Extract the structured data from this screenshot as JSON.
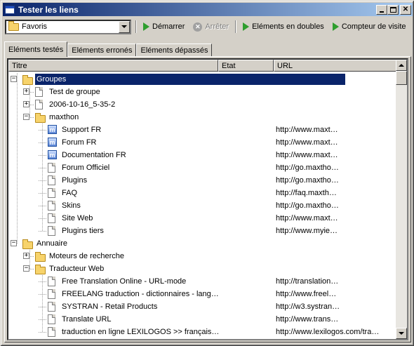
{
  "window": {
    "title": "Tester les liens"
  },
  "toolbar": {
    "combo_value": "Favoris",
    "start": "Démarrer",
    "stop": "Arrêter",
    "duplicates": "Eléments en doubles",
    "visit_counter": "Compteur de visite"
  },
  "tabs": [
    "Eléments testés",
    "Eléments erronés",
    "Eléments dépassés"
  ],
  "columns": {
    "title": "Titre",
    "state": "Etat",
    "url": "URL"
  },
  "rows": [
    {
      "name": "Groupes",
      "url": "",
      "icon": "folder-icon",
      "level": 0,
      "expander": "−",
      "selected": true
    },
    {
      "name": "Test de groupe",
      "url": "",
      "icon": "page-icon",
      "level": 1,
      "expander": "+"
    },
    {
      "name": "2006-10-16_5-35-2",
      "url": "",
      "icon": "page-icon",
      "level": 1,
      "expander": "+"
    },
    {
      "name": "maxthon",
      "url": "",
      "icon": "folder-icon",
      "level": 1,
      "expander": "−"
    },
    {
      "name": "Support FR",
      "url": "http://www.maxt…",
      "icon": "maxthon-icon",
      "level": 2
    },
    {
      "name": "Forum FR",
      "url": "http://www.maxt…",
      "icon": "maxthon-icon",
      "level": 2
    },
    {
      "name": "Documentation FR",
      "url": "http://www.maxt…",
      "icon": "maxthon-icon",
      "level": 2
    },
    {
      "name": "Forum Officiel",
      "url": "http://go.maxtho…",
      "icon": "page-icon",
      "level": 2
    },
    {
      "name": "Plugins",
      "url": "http://go.maxtho…",
      "icon": "page-icon",
      "level": 2
    },
    {
      "name": "FAQ",
      "url": "http://faq.maxth…",
      "icon": "page-icon",
      "level": 2
    },
    {
      "name": "Skins",
      "url": "http://go.maxtho…",
      "icon": "page-icon",
      "level": 2
    },
    {
      "name": "Site Web",
      "url": "http://www.maxt…",
      "icon": "page-icon",
      "level": 2
    },
    {
      "name": "Plugins tiers",
      "url": "http://www.myie…",
      "icon": "page-icon",
      "level": 2
    },
    {
      "name": "Annuaire",
      "url": "",
      "icon": "folder-icon",
      "level": 0,
      "expander": "−"
    },
    {
      "name": "Moteurs de recherche",
      "url": "",
      "icon": "folder-icon",
      "level": 1,
      "expander": "+"
    },
    {
      "name": "Traducteur Web",
      "url": "",
      "icon": "folder-icon",
      "level": 1,
      "expander": "−"
    },
    {
      "name": "Free Translation Online - URL-mode",
      "url": "http://translation…",
      "icon": "page-icon",
      "level": 2
    },
    {
      "name": "FREELANG traduction - dictionnaires - lang…",
      "url": "http://www.freel…",
      "icon": "page-icon",
      "level": 2
    },
    {
      "name": "SYSTRAN - Retail Products",
      "url": "http://w3.systran…",
      "icon": "page-icon",
      "level": 2
    },
    {
      "name": "Translate URL",
      "url": "http://www.trans…",
      "icon": "page-icon",
      "level": 2
    },
    {
      "name": "traduction en ligne LEXILOGOS >> français…",
      "url": "http://www.lexilogos.com/tra…",
      "icon": "page-icon",
      "level": 2
    }
  ]
}
